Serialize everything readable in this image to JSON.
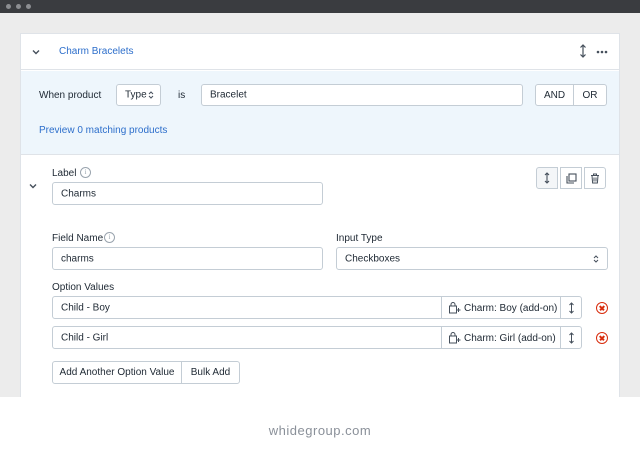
{
  "header": {
    "title": "Charm Bracelets"
  },
  "rule": {
    "when_label": "When product",
    "type_select": "Type",
    "is_label": "is",
    "value": "Bracelet",
    "and_label": "AND",
    "or_label": "OR",
    "preview_link": "Preview 0 matching products"
  },
  "field": {
    "label_caption": "Label",
    "label_value": "Charms",
    "field_name_caption": "Field Name",
    "field_name_value": "charms",
    "input_type_caption": "Input Type",
    "input_type_value": "Checkboxes",
    "option_values_caption": "Option Values",
    "options": [
      {
        "value": "Child - Boy",
        "addon": "Charm: Boy (add-on)"
      },
      {
        "value": "Child - Girl",
        "addon": "Charm: Girl (add-on)"
      }
    ],
    "add_option_label": "Add Another Option Value",
    "bulk_add_label": "Bulk Add"
  },
  "footer": {
    "watermark": "whidegroup.com"
  },
  "colors": {
    "accent": "#2c6ecb",
    "rule_band": "#eef6fc",
    "danger": "#d82c0d",
    "border": "#c4cdd5"
  }
}
